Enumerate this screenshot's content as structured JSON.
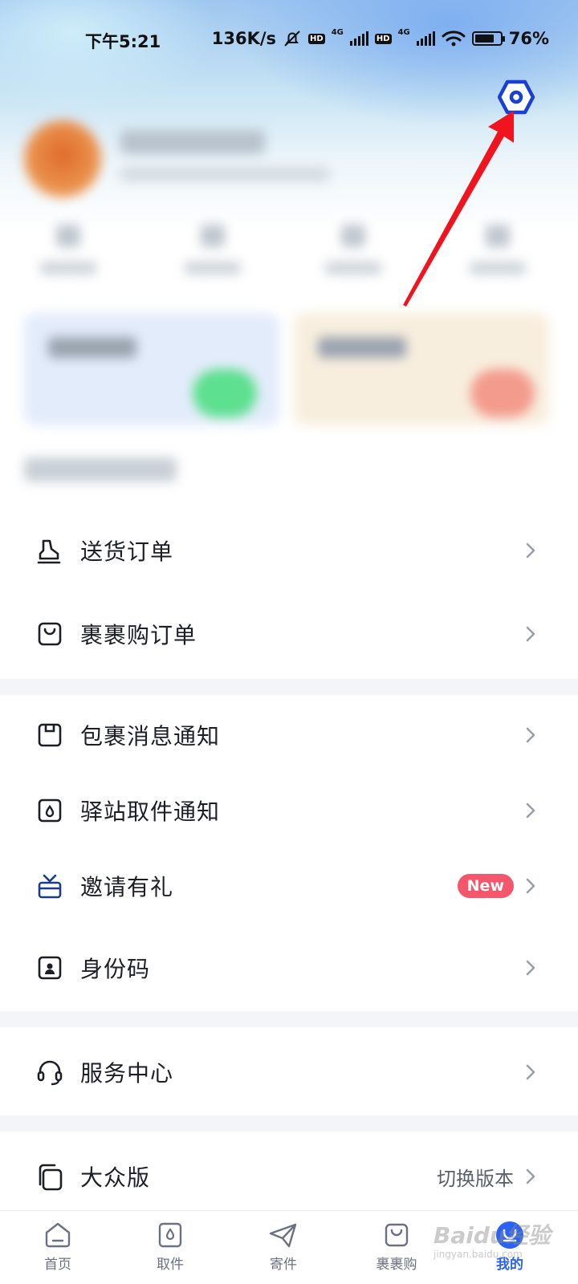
{
  "status_bar": {
    "time": "下午5:21",
    "net_speed": "136K/s",
    "hd1": "HD",
    "net1": "4G",
    "hd2": "HD",
    "net2": "4G",
    "battery": "76%"
  },
  "header": {
    "settings_icon": "settings-hexagon-icon",
    "annotation": "red-arrow-pointing-to-settings"
  },
  "menu": {
    "group1": [
      {
        "label": "送货订单",
        "icon": "delivery-icon"
      },
      {
        "label": "裹裹购订单",
        "icon": "shopping-bag-icon"
      }
    ],
    "group2": [
      {
        "label": "包裹消息通知",
        "icon": "package-icon"
      },
      {
        "label": "驿站取件通知",
        "icon": "station-pickup-icon"
      },
      {
        "label": "邀请有礼",
        "icon": "gift-icon",
        "badge": "New"
      },
      {
        "label": "身份码",
        "icon": "id-code-icon"
      }
    ],
    "group3": [
      {
        "label": "服务中心",
        "icon": "headset-icon"
      }
    ],
    "group4": [
      {
        "label": "大众版",
        "icon": "copy-icon",
        "right_text": "切换版本"
      }
    ]
  },
  "tabbar": {
    "tabs": [
      {
        "label": "首页",
        "icon": "home-icon"
      },
      {
        "label": "取件",
        "icon": "pickup-icon"
      },
      {
        "label": "寄件",
        "icon": "send-icon"
      },
      {
        "label": "裹裹购",
        "icon": "bag-icon"
      },
      {
        "label": "我的",
        "icon": "profile-icon",
        "active": true
      }
    ]
  },
  "watermark": {
    "text": "Baidu经验",
    "sub": "jingyan.baidu.com"
  },
  "colors": {
    "accent": "#2a63f2",
    "badge": "#f5566b",
    "arrow": "#f0141e",
    "settings_icon": "#1a3fd6"
  }
}
